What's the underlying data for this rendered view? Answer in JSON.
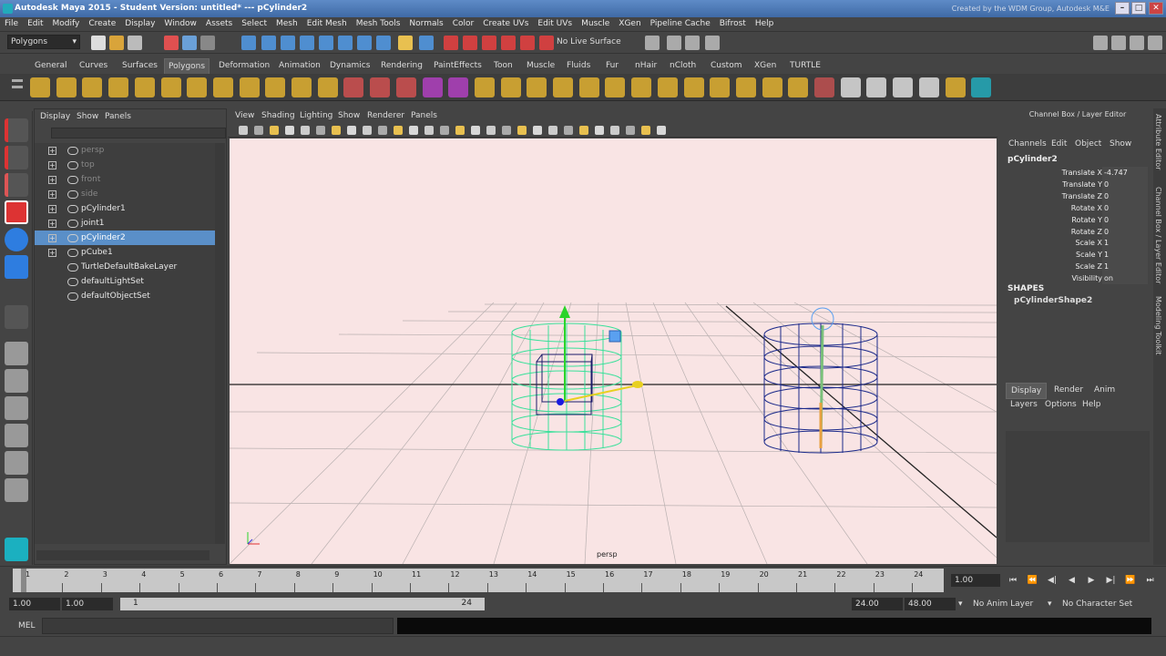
{
  "window": {
    "title": "Autodesk Maya 2015 - Student Version: untitled*   ---   pCylinder2",
    "right_text": "Created by the WDM Group, Autodesk M&E",
    "buttons": [
      "–",
      "□",
      "✕"
    ]
  },
  "menubar": [
    "File",
    "Edit",
    "Modify",
    "Create",
    "Display",
    "Window",
    "Assets",
    "Select",
    "Mesh",
    "Edit Mesh",
    "Mesh Tools",
    "Normals",
    "Color",
    "Create UVs",
    "Edit UVs",
    "Muscle",
    "XGen",
    "Pipeline Cache",
    "Bifrost",
    "Help"
  ],
  "statusline": {
    "menuset": "Polygons",
    "live_surface": "No Live Surface"
  },
  "shelf": {
    "tabs": [
      "General",
      "Curves",
      "Surfaces",
      "Polygons",
      "Deformation",
      "Animation",
      "Dynamics",
      "Rendering",
      "PaintEffects",
      "Toon",
      "Muscle",
      "Fluids",
      "Fur",
      "nHair",
      "nCloth",
      "Custom",
      "XGen",
      "TURTLE"
    ],
    "active_tab": "Polygons"
  },
  "outliner": {
    "menu": [
      "Display",
      "Show",
      "Panels"
    ],
    "rows": [
      {
        "label": "persp",
        "dim": true,
        "expand": true,
        "selected": false
      },
      {
        "label": "top",
        "dim": true,
        "expand": true,
        "selected": false
      },
      {
        "label": "front",
        "dim": true,
        "expand": true,
        "selected": false
      },
      {
        "label": "side",
        "dim": true,
        "expand": true,
        "selected": false
      },
      {
        "label": "pCylinder1",
        "dim": false,
        "expand": true,
        "selected": false
      },
      {
        "label": "joint1",
        "dim": false,
        "expand": true,
        "selected": false
      },
      {
        "label": "pCylinder2",
        "dim": false,
        "expand": true,
        "selected": true
      },
      {
        "label": "pCube1",
        "dim": false,
        "expand": true,
        "selected": false
      },
      {
        "label": "TurtleDefaultBakeLayer",
        "dim": false,
        "expand": false,
        "selected": false
      },
      {
        "label": "defaultLightSet",
        "dim": false,
        "expand": false,
        "selected": false
      },
      {
        "label": "defaultObjectSet",
        "dim": false,
        "expand": false,
        "selected": false
      }
    ]
  },
  "viewport": {
    "menu": [
      "View",
      "Shading",
      "Lighting",
      "Show",
      "Renderer",
      "Panels"
    ],
    "camera_label": "persp",
    "background": "#f9e4e4"
  },
  "channelbox": {
    "header": "Channel Box / Layer Editor",
    "menu": [
      "Channels",
      "Edit",
      "Object",
      "Show"
    ],
    "object": "pCylinder2",
    "attributes": [
      {
        "name": "Translate X",
        "value": "-4.747"
      },
      {
        "name": "Translate Y",
        "value": "0"
      },
      {
        "name": "Translate Z",
        "value": "0"
      },
      {
        "name": "Rotate X",
        "value": "0"
      },
      {
        "name": "Rotate Y",
        "value": "0"
      },
      {
        "name": "Rotate Z",
        "value": "0"
      },
      {
        "name": "Scale X",
        "value": "1"
      },
      {
        "name": "Scale Y",
        "value": "1"
      },
      {
        "name": "Scale Z",
        "value": "1"
      },
      {
        "name": "Visibility",
        "value": "on"
      }
    ],
    "shapes_label": "SHAPES",
    "shape_name": "pCylinderShape2",
    "layer_tabs": [
      "Display",
      "Render",
      "Anim"
    ],
    "layer_menu": [
      "Layers",
      "Options",
      "Help"
    ]
  },
  "side_tabs": [
    "Attribute Editor",
    "Channel Box / Layer Editor",
    "Modeling Toolkit"
  ],
  "timeslider": {
    "ticks": [
      "1",
      "2",
      "3",
      "4",
      "5",
      "6",
      "7",
      "8",
      "9",
      "10",
      "11",
      "12",
      "13",
      "14",
      "15",
      "16",
      "17",
      "18",
      "19",
      "20",
      "21",
      "22",
      "23",
      "24"
    ],
    "current_frame": "1.00",
    "playback_buttons": [
      "⏮",
      "⏪",
      "◀|",
      "◀",
      "▶",
      "▶|",
      "⏩",
      "⏭"
    ]
  },
  "rangeslider": {
    "start": "1.00",
    "inner_start": "1.00",
    "bar_start": "1",
    "bar_end": "24",
    "end": "24.00",
    "outer_end": "48.00",
    "anim_layer": "No Anim Layer",
    "char_set": "No Character Set"
  },
  "cmdline": {
    "label": "MEL"
  }
}
